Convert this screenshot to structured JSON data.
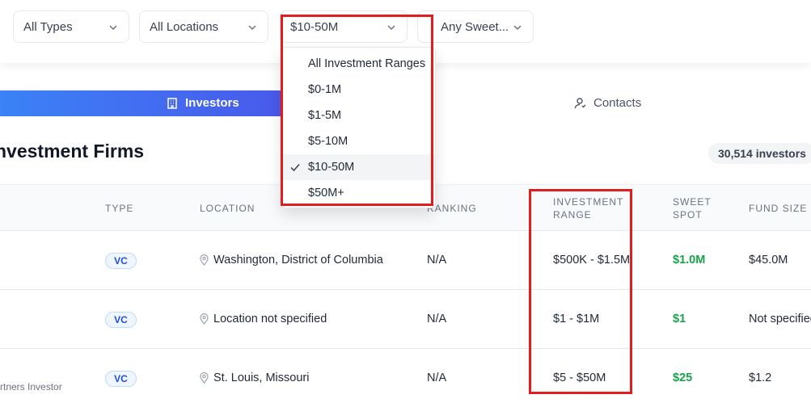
{
  "filters": {
    "type": "All Types",
    "location": "All Locations",
    "range": "$10-50M",
    "sweet_spot": "Any Sweet..."
  },
  "range_menu": {
    "options": [
      "All Investment Ranges",
      "$0-1M",
      "$1-5M",
      "$5-10M",
      "$10-50M",
      "$50M+"
    ],
    "selected": "$10-50M"
  },
  "tabs": {
    "investors": "Investors",
    "contacts": "Contacts"
  },
  "heading": "nvestment Firms",
  "investor_count": "30,514 investors",
  "table": {
    "headers": {
      "type": "TYPE",
      "location": "LOCATION",
      "ranking": "RANKING",
      "range_1": "INVESTMENT",
      "range_2": "RANGE",
      "sweet_1": "SWEET",
      "sweet_2": "SPOT",
      "fund_size": "FUND SIZE"
    },
    "rows": [
      {
        "type": "VC",
        "location": "Washington, District of Columbia",
        "ranking": "N/A",
        "range": "$500K - $1.5M",
        "sweet_spot": "$1.0M",
        "fund_size": "$45.0M",
        "sub": ""
      },
      {
        "type": "VC",
        "location": "Location not specified",
        "ranking": "N/A",
        "range": "$1 - $1M",
        "sweet_spot": "$1",
        "fund_size": "Not specified",
        "sub": ""
      },
      {
        "type": "VC",
        "location": "St. Louis, Missouri",
        "ranking": "N/A",
        "range": "$5 - $50M",
        "sweet_spot": "$25",
        "fund_size": "$1.2",
        "sub": "rtners Investor"
      }
    ]
  },
  "colors": {
    "highlight": "#e11d1d",
    "accent_start": "#3b82f6",
    "accent_end": "#4f46e5",
    "sweet_green": "#16a34a"
  }
}
